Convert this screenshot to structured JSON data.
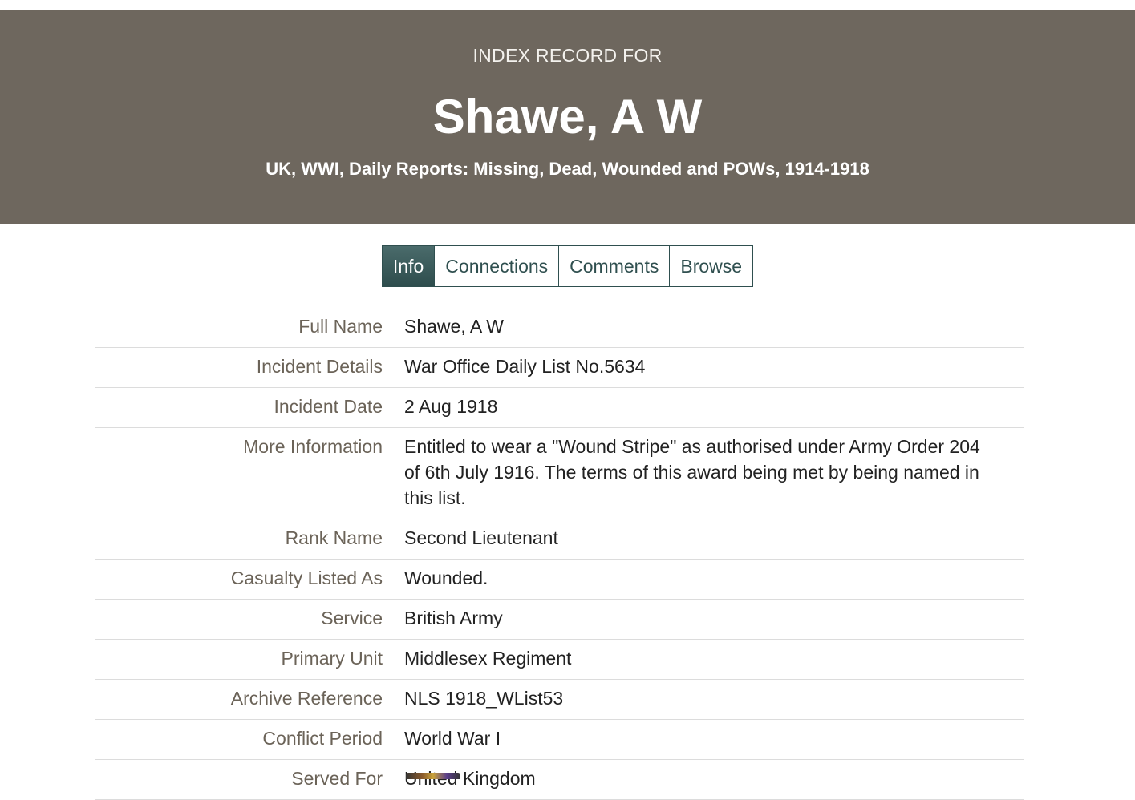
{
  "header": {
    "eyebrow": "INDEX RECORD FOR",
    "title": "Shawe, A W",
    "collection": "UK, WWI, Daily Reports: Missing, Dead, Wounded and POWs, 1914-1918"
  },
  "tabs": [
    {
      "label": "Info",
      "active": true
    },
    {
      "label": "Connections",
      "active": false
    },
    {
      "label": "Comments",
      "active": false
    },
    {
      "label": "Browse",
      "active": false
    }
  ],
  "details": [
    {
      "label": "Full Name",
      "value": "Shawe, A W"
    },
    {
      "label": "Incident Details",
      "value": "War Office Daily List No.5634"
    },
    {
      "label": "Incident Date",
      "value": "2 Aug 1918"
    },
    {
      "label": "More Information",
      "value": "Entitled to wear a \"Wound Stripe\" as authorised under Army Order 204 of 6th July 1916. The terms of this award being met by being named in this list."
    },
    {
      "label": "Rank Name",
      "value": "Second Lieutenant"
    },
    {
      "label": "Casualty Listed As",
      "value": "Wounded."
    },
    {
      "label": "Service",
      "value": "British Army"
    },
    {
      "label": "Primary Unit",
      "value": "Middlesex Regiment"
    },
    {
      "label": "Archive Reference",
      "value": "NLS 1918_WList53"
    },
    {
      "label": "Conflict Period",
      "value": "World War I"
    },
    {
      "label": "Served For",
      "value": "United Kingdom"
    }
  ],
  "colors": {
    "header_bg": "#6e675e",
    "tab_accent": "#2f4f4f",
    "label_text": "#6b6358"
  }
}
